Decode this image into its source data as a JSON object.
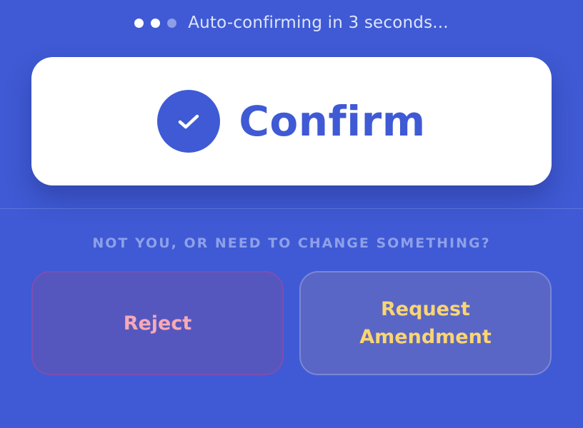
{
  "status": {
    "text": "Auto-confirming in 3 seconds..."
  },
  "confirm": {
    "label": "Confirm"
  },
  "prompt": {
    "text": "NOT YOU, OR NEED TO CHANGE SOMETHING?"
  },
  "actions": {
    "reject_label": "Reject",
    "amend_line1": "Request",
    "amend_line2": "Amendment"
  },
  "colors": {
    "background": "#3f5ad4",
    "confirm_text": "#3f5ad4",
    "reject_text": "#f6a9b6",
    "amend_text": "#fad572"
  },
  "icons": {
    "status_dots": "progress-dots-icon",
    "confirm": "check-icon"
  }
}
